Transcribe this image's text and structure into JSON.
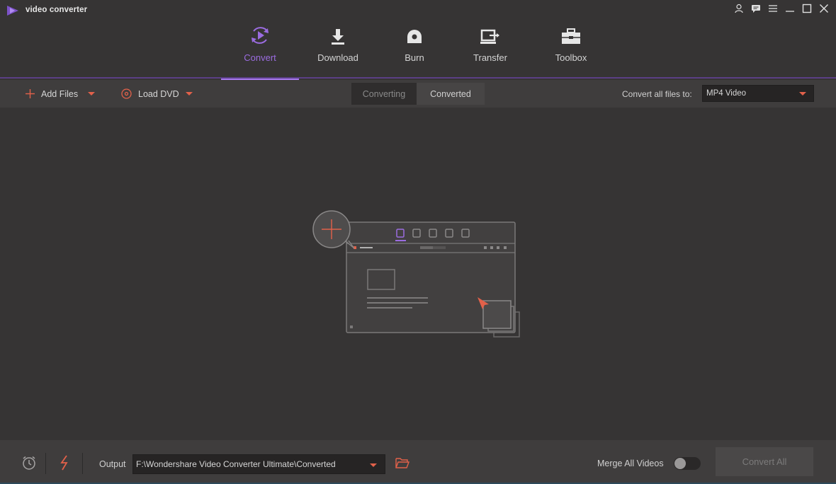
{
  "app": {
    "title": "video converter"
  },
  "window_controls": [
    {
      "name": "account-icon"
    },
    {
      "name": "feedback-icon"
    },
    {
      "name": "menu-icon"
    },
    {
      "name": "minimize-icon"
    },
    {
      "name": "maximize-icon"
    },
    {
      "name": "close-icon"
    }
  ],
  "nav": {
    "active": "Convert",
    "items": [
      {
        "label": "Convert",
        "icon": "convert-icon"
      },
      {
        "label": "Download",
        "icon": "download-icon"
      },
      {
        "label": "Burn",
        "icon": "burn-icon"
      },
      {
        "label": "Transfer",
        "icon": "transfer-icon"
      },
      {
        "label": "Toolbox",
        "icon": "toolbox-icon"
      }
    ]
  },
  "toolbar": {
    "add_files": "Add Files",
    "load_dvd": "Load DVD",
    "tabs": {
      "converting": "Converting",
      "converted": "Converted",
      "selected": "Converted"
    },
    "convert_all_label": "Convert all files to:",
    "format_value": "MP4 Video"
  },
  "bottom": {
    "output_label": "Output",
    "output_path": "F:\\Wondershare Video Converter Ultimate\\Converted",
    "merge_label": "Merge All Videos",
    "merge_enabled": false,
    "convert_all_button": "Convert All"
  },
  "colors": {
    "accent_purple": "#a878f0",
    "accent_orange": "#e2614a",
    "background": "#363434",
    "toolbar": "#3f3d3d"
  }
}
